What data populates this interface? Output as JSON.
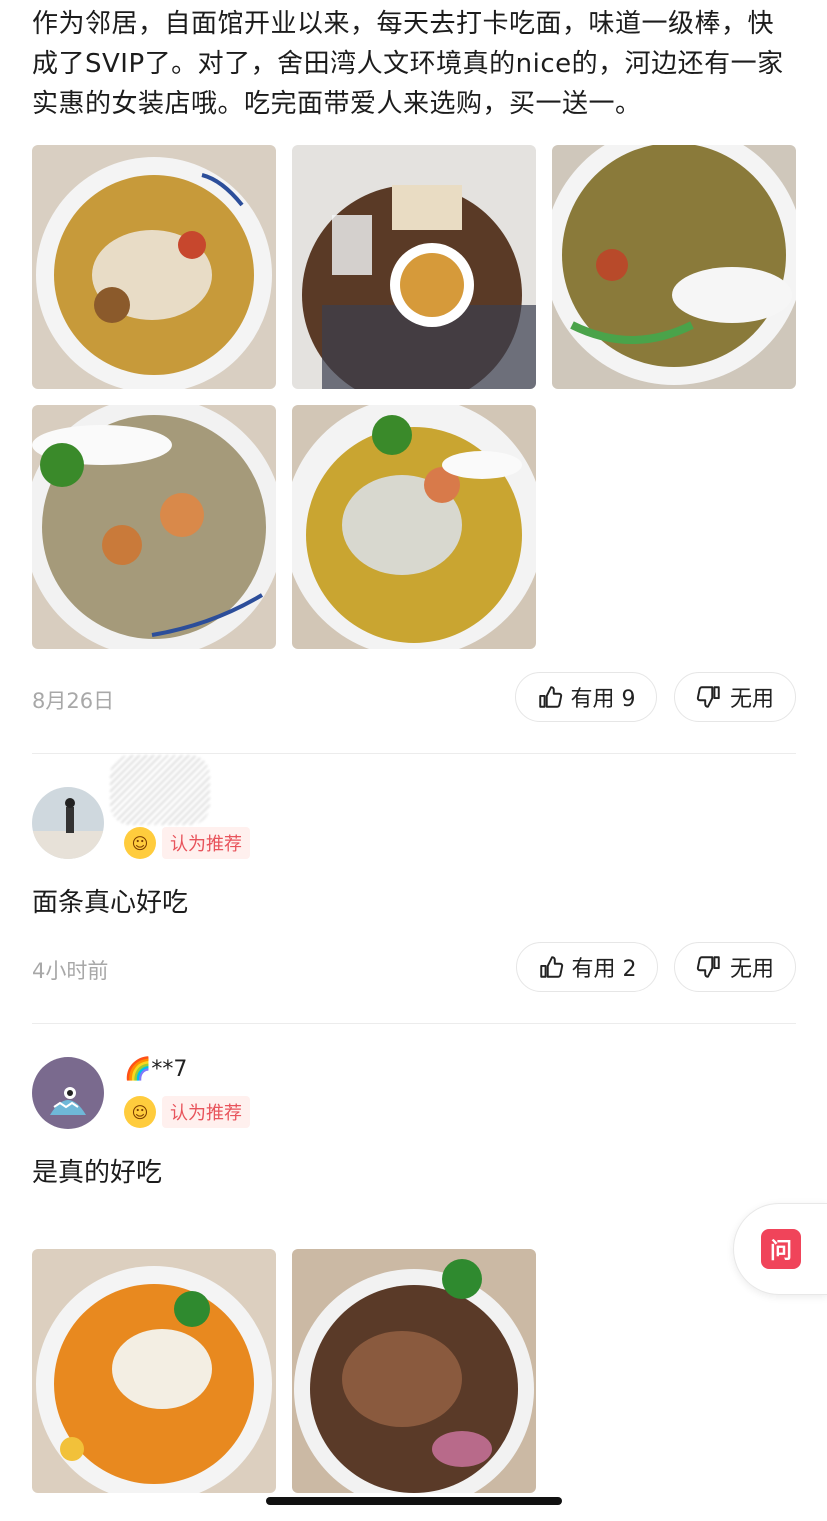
{
  "post": {
    "text": "作为邻居，自面馆开业以来，每天去打卡吃面，味道一级棒，快成了SVIP了。对了，舍田湾人文环境真的nice的，河边还有一家实惠的女装店哦。吃完面带爱人来选购，买一送一。",
    "date": "8月26日",
    "useful_label": "有用 9",
    "useless_label": "无用"
  },
  "comments": [
    {
      "username": "",
      "badge": "认为推荐",
      "text": "面条真心好吃",
      "time": "4小时前",
      "useful_label": "有用 2",
      "useless_label": "无用"
    },
    {
      "username": "🌈**7",
      "badge": "认为推荐",
      "text": "是真的好吃"
    }
  ],
  "floating": {
    "ask_label": "问"
  },
  "icons": {
    "thumb_up": "thumbs-up-icon",
    "thumb_down": "thumbs-down-icon",
    "badge_emoji": "smile-emoji-icon"
  },
  "colors": {
    "accent_red": "#e8545c",
    "ask_red": "#f0445a",
    "muted_gray": "#a8a8a8"
  }
}
